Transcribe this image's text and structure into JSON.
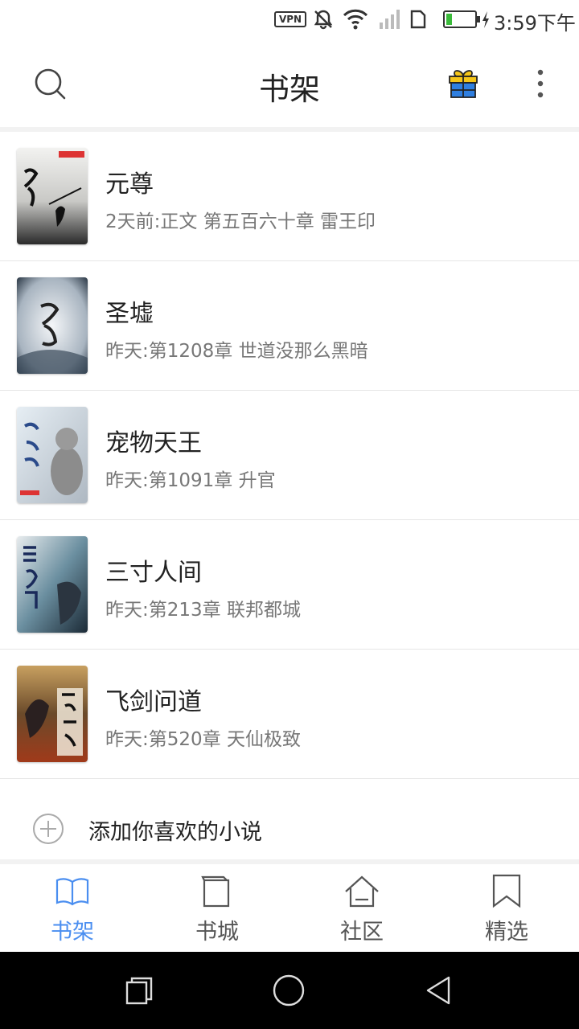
{
  "status_bar": {
    "vpn": "VPN",
    "time": "3:59下午",
    "battery_level": 0.2,
    "icons": [
      "vpn-icon",
      "notifications-off-icon",
      "wifi-icon",
      "signal-icon",
      "sim-icon",
      "battery-icon",
      "charging-icon"
    ]
  },
  "header": {
    "title": "书架",
    "icons": [
      "search-icon",
      "gift-icon",
      "more-vertical-icon"
    ],
    "accent": "#2f7fe0"
  },
  "books": [
    {
      "title": "元尊",
      "subtitle": "2天前:正文 第五百六十章  雷王印"
    },
    {
      "title": "圣墟",
      "subtitle": "昨天:第1208章 世道没那么黑暗"
    },
    {
      "title": "宠物天王",
      "subtitle": "昨天:第1091章 升官"
    },
    {
      "title": "三寸人间",
      "subtitle": "昨天:第213章 联邦都城"
    },
    {
      "title": "飞剑问道",
      "subtitle": "昨天:第520章 天仙极致"
    }
  ],
  "add_book": {
    "label": "添加你喜欢的小说",
    "icon": "plus-circle-icon"
  },
  "tabs": [
    {
      "label": "书架",
      "icon": "open-book-icon",
      "active": true
    },
    {
      "label": "书城",
      "icon": "books-icon",
      "active": false
    },
    {
      "label": "社区",
      "icon": "home-icon",
      "active": false
    },
    {
      "label": "精选",
      "icon": "bookmark-icon",
      "active": false
    }
  ],
  "colors": {
    "active_tab": "#4a8ef0",
    "inactive_tab": "#555555",
    "subtitle": "#777777"
  },
  "system_nav": [
    "recents-icon",
    "home-circle-icon",
    "back-icon"
  ]
}
